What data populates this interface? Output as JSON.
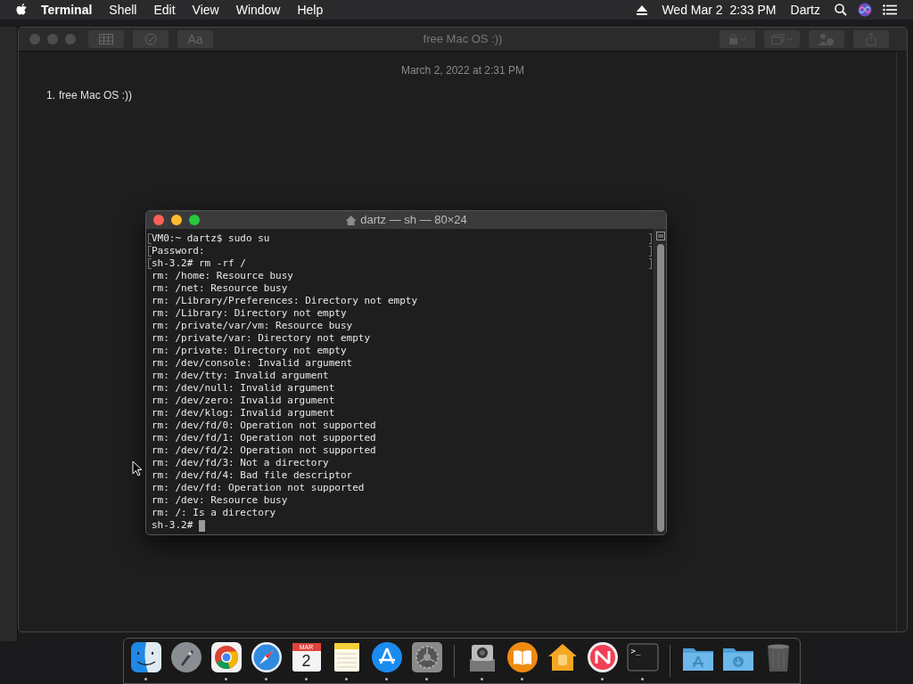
{
  "menu_bar": {
    "app": "Terminal",
    "menus": [
      "Shell",
      "Edit",
      "View",
      "Window",
      "Help"
    ],
    "clock": "Wed Mar 2  2:33 PM",
    "user": "Dartz"
  },
  "notes_window": {
    "title": "free Mac OS :))",
    "format_button": "Aa",
    "date": "March 2, 2022 at 2:31 PM",
    "list": [
      {
        "number": "1.",
        "text": "free Mac OS :))"
      }
    ]
  },
  "terminal": {
    "title": "dartz — sh — 80×24",
    "lines": [
      {
        "text": "VM0:~ dartz$ sudo su",
        "marked": true
      },
      {
        "text": "Password:",
        "marked": true
      },
      {
        "text": "sh-3.2# rm -rf /",
        "marked": true
      },
      {
        "text": "rm: /home: Resource busy",
        "marked": false
      },
      {
        "text": "rm: /net: Resource busy",
        "marked": false
      },
      {
        "text": "rm: /Library/Preferences: Directory not empty",
        "marked": false
      },
      {
        "text": "rm: /Library: Directory not empty",
        "marked": false
      },
      {
        "text": "rm: /private/var/vm: Resource busy",
        "marked": false
      },
      {
        "text": "rm: /private/var: Directory not empty",
        "marked": false
      },
      {
        "text": "rm: /private: Directory not empty",
        "marked": false
      },
      {
        "text": "rm: /dev/console: Invalid argument",
        "marked": false
      },
      {
        "text": "rm: /dev/tty: Invalid argument",
        "marked": false
      },
      {
        "text": "rm: /dev/null: Invalid argument",
        "marked": false
      },
      {
        "text": "rm: /dev/zero: Invalid argument",
        "marked": false
      },
      {
        "text": "rm: /dev/klog: Invalid argument",
        "marked": false
      },
      {
        "text": "rm: /dev/fd/0: Operation not supported",
        "marked": false
      },
      {
        "text": "rm: /dev/fd/1: Operation not supported",
        "marked": false
      },
      {
        "text": "rm: /dev/fd/2: Operation not supported",
        "marked": false
      },
      {
        "text": "rm: /dev/fd/3: Not a directory",
        "marked": false
      },
      {
        "text": "rm: /dev/fd/4: Bad file descriptor",
        "marked": false
      },
      {
        "text": "rm: /dev/fd: Operation not supported",
        "marked": false
      },
      {
        "text": "rm: /dev: Resource busy",
        "marked": false
      },
      {
        "text": "rm: /: Is a directory",
        "marked": false
      }
    ],
    "prompt": "sh-3.2#"
  },
  "dock": {
    "items": [
      {
        "kind": "finder",
        "running": true
      },
      {
        "kind": "launchpad",
        "running": false
      },
      {
        "kind": "chrome",
        "running": true
      },
      {
        "kind": "safari",
        "running": true
      },
      {
        "kind": "calendar",
        "running": true,
        "month": "MAR",
        "day": "2"
      },
      {
        "kind": "notes",
        "running": true
      },
      {
        "kind": "appstore",
        "running": true
      },
      {
        "kind": "settings",
        "running": true
      },
      {
        "kind": "separator"
      },
      {
        "kind": "capture",
        "running": true
      },
      {
        "kind": "books",
        "running": true
      },
      {
        "kind": "home",
        "running": false
      },
      {
        "kind": "news",
        "running": true
      },
      {
        "kind": "terminal",
        "running": true,
        "glyph": ">_"
      },
      {
        "kind": "separator"
      },
      {
        "kind": "apps-folder",
        "running": false
      },
      {
        "kind": "downloads-folder",
        "running": false
      },
      {
        "kind": "trash",
        "running": false
      }
    ]
  }
}
